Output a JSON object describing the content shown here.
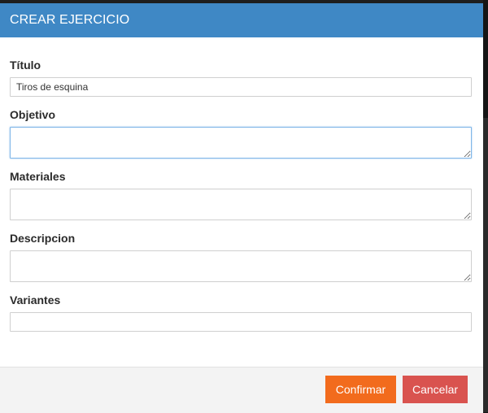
{
  "modal": {
    "title": "CREAR EJERCICIO"
  },
  "form": {
    "titulo": {
      "label": "Título",
      "value": "Tiros de esquina"
    },
    "objetivo": {
      "label": "Objetivo",
      "value": ""
    },
    "materiales": {
      "label": "Materiales",
      "value": ""
    },
    "descripcion": {
      "label": "Descripcion",
      "value": ""
    },
    "variantes": {
      "label": "Variantes",
      "value": ""
    }
  },
  "footer": {
    "confirm_label": "Confirmar",
    "cancel_label": "Cancelar"
  },
  "colors": {
    "header": "#3f88c5",
    "confirm": "#f26b1d",
    "cancel": "#d9534f"
  }
}
